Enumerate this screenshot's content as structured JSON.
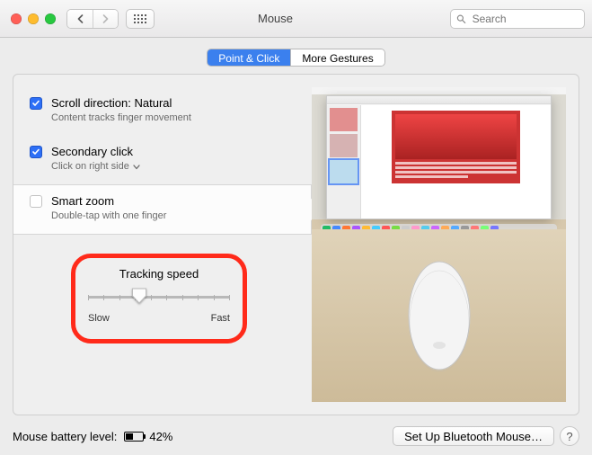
{
  "window": {
    "title": "Mouse"
  },
  "toolbar": {
    "search_placeholder": "Search"
  },
  "tabs": [
    {
      "label": "Point & Click",
      "active": true
    },
    {
      "label": "More Gestures",
      "active": false
    }
  ],
  "options": [
    {
      "title": "Scroll direction: Natural",
      "desc": "Content tracks finger movement",
      "checked": true
    },
    {
      "title": "Secondary click",
      "desc": "Click on right side",
      "checked": true,
      "has_dropdown": true
    },
    {
      "title": "Smart zoom",
      "desc": "Double-tap with one finger",
      "checked": false,
      "selected": true
    }
  ],
  "tracking": {
    "title": "Tracking speed",
    "slow_label": "Slow",
    "fast_label": "Fast",
    "value": 3,
    "max": 9
  },
  "footer": {
    "battery_label": "Mouse battery level:",
    "battery_pct": "42%",
    "bt_button": "Set Up Bluetooth Mouse…",
    "help": "?"
  }
}
